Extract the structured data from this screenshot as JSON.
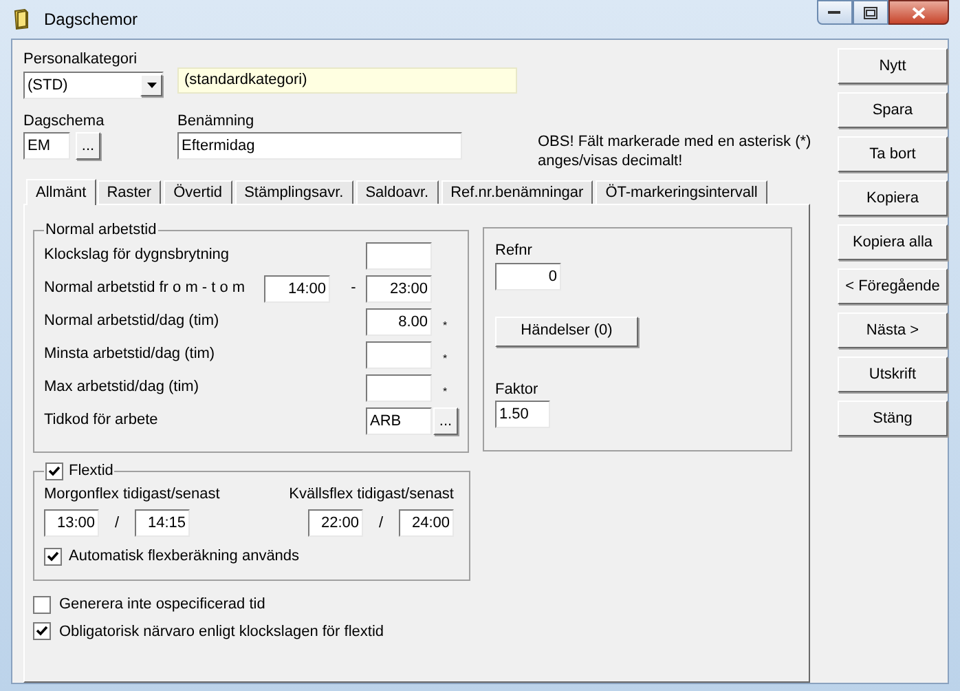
{
  "window": {
    "title": "Dagschemor"
  },
  "personalkategori": {
    "label": "Personalkategori",
    "value": "(STD)",
    "name": "(standardkategori)"
  },
  "dagschema": {
    "label": "Dagschema",
    "value": "EM",
    "browse": "..."
  },
  "benamning": {
    "label": "Benämning",
    "value": "Eftermidag"
  },
  "note": "OBS! Fält markerade med en asterisk (*) anges/visas decimalt!",
  "tabs": [
    {
      "label": "Allmänt",
      "selected": true
    },
    {
      "label": "Raster",
      "selected": false
    },
    {
      "label": "Övertid",
      "selected": false
    },
    {
      "label": "Stämplingsavr.",
      "selected": false
    },
    {
      "label": "Saldoavr.",
      "selected": false
    },
    {
      "label": "Ref.nr.benämningar",
      "selected": false
    },
    {
      "label": "ÖT-markeringsintervall",
      "selected": false
    }
  ],
  "normal_arbetstid": {
    "title": "Normal arbetstid",
    "rows": [
      {
        "kind": "field",
        "label": "Klockslag för dygnsbrytning"
      },
      {
        "kind": "range",
        "label": "Normal arbetstid fr o m - t o m",
        "from": "14:00",
        "separator": "-",
        "value": "23:00"
      },
      {
        "kind": "field",
        "label": "Normal arbetstid/dag (tim)",
        "value": "8.00",
        "asterisk": "*"
      },
      {
        "kind": "field",
        "label": "Minsta arbetstid/dag (tim)",
        "asterisk": "*"
      },
      {
        "kind": "field",
        "label": "Max arbetstid/dag (tim)",
        "asterisk": "*"
      },
      {
        "kind": "lookup",
        "label": "Tidkod för arbete",
        "value": "ARB",
        "browse": "..."
      }
    ]
  },
  "refnr": {
    "label": "Refnr",
    "value": "0",
    "events_button": "Händelser (0)",
    "faktor_label": "Faktor",
    "faktor_value": "1.50"
  },
  "flextid": {
    "label": "Flextid",
    "checked": true,
    "ranges": [
      {
        "label": "Morgonflex tidigast/senast",
        "from": "13:00",
        "separator": "/",
        "to": "14:15"
      },
      {
        "label": "Kvällsflex tidigast/senast",
        "from": "22:00",
        "separator": "/",
        "to": "24:00"
      }
    ],
    "auto": {
      "label": "Automatisk flexberäkning används",
      "checked": true
    }
  },
  "options": [
    {
      "label": "Generera inte ospecificerad tid",
      "checked": false
    },
    {
      "label": "Obligatorisk närvaro enligt klockslagen för flextid",
      "checked": true
    }
  ],
  "buttons": [
    "Nytt",
    "Spara",
    "Ta bort",
    "Kopiera",
    "Kopiera alla",
    "< Föregående",
    "Nästa >",
    "Utskrift",
    "Stäng"
  ]
}
